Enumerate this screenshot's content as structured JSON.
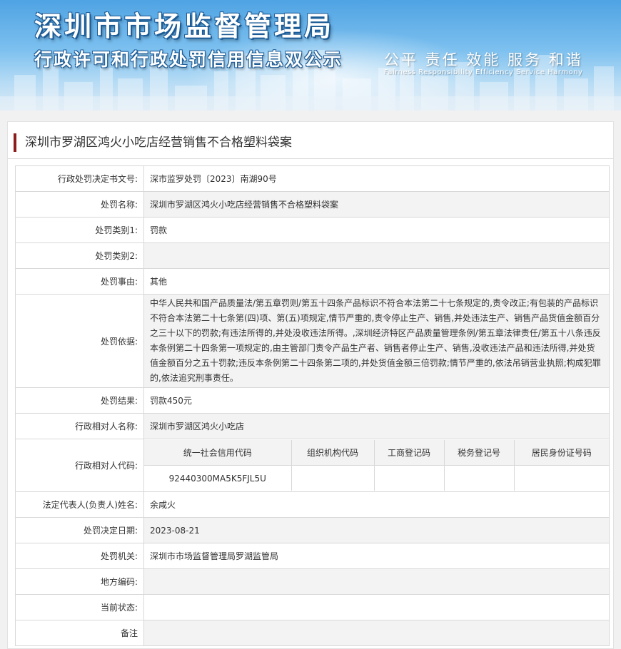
{
  "banner": {
    "title": "深圳市市场监督管理局",
    "subtitle": "行政许可和行政处罚信用信息双公示",
    "slogan": "公平 责任 效能 服务 和谐",
    "slogan_en": "Fairness Responsibility Efficiency Service Harmony"
  },
  "case": {
    "title": "深圳市罗湖区鸿火小吃店经营销售不合格塑料袋案"
  },
  "rows": {
    "doc_no": {
      "label": "行政处罚决定书文号:",
      "value": "深市监罗处罚〔2023〕南湖90号"
    },
    "name": {
      "label": "处罚名称:",
      "value": "深圳市罗湖区鸿火小吃店经营销售不合格塑料袋案"
    },
    "type1": {
      "label": "处罚类别1:",
      "value": "罚款"
    },
    "type2": {
      "label": "处罚类别2:",
      "value": ""
    },
    "reason": {
      "label": "处罚事由:",
      "value": "其他"
    },
    "basis": {
      "label": "处罚依据:",
      "value": "中华人民共和国产品质量法/第五章罚则/第五十四条产品标识不符合本法第二十七条规定的,责令改正;有包装的产品标识不符合本法第二十七条第(四)项、第(五)项规定,情节严重的,责令停止生产、销售,并处违法生产、销售产品货值金额百分之三十以下的罚款;有违法所得的,并处没收违法所得。,深圳经济特区产品质量管理条例/第五章法律责任/第五十八条违反本条例第二十四条第一项规定的,由主管部门责令产品生产者、销售者停止生产、销售,没收违法产品和违法所得,并处货值金额百分之五十罚款;违反本条例第二十四条第二项的,并处货值金额三倍罚款;情节严重的,依法吊销营业执照;构成犯罪的,依法追究刑事责任。"
    },
    "result": {
      "label": "处罚结果:",
      "value": "罚款450元"
    },
    "party": {
      "label": "行政相对人名称:",
      "value": "深圳市罗湖区鸿火小吃店"
    },
    "codes": {
      "label": "行政相对人代码:",
      "headers": [
        "统一社会信用代码",
        "组织机构代码",
        "工商登记码",
        "税务登记号",
        "居民身份证号码"
      ],
      "values": [
        "92440300MA5K5FJL5U",
        "",
        "",
        "",
        ""
      ]
    },
    "legal_rep": {
      "label": "法定代表人(负责人)姓名:",
      "value": "余咸火"
    },
    "date": {
      "label": "处罚决定日期:",
      "value": "2023-08-21"
    },
    "authority": {
      "label": "处罚机关:",
      "value": "深圳市市场监督管理局罗湖监管局"
    },
    "region": {
      "label": "地方编码:",
      "value": ""
    },
    "status": {
      "label": "当前状态:",
      "value": ""
    },
    "remark": {
      "label": "备注",
      "value": ""
    }
  }
}
